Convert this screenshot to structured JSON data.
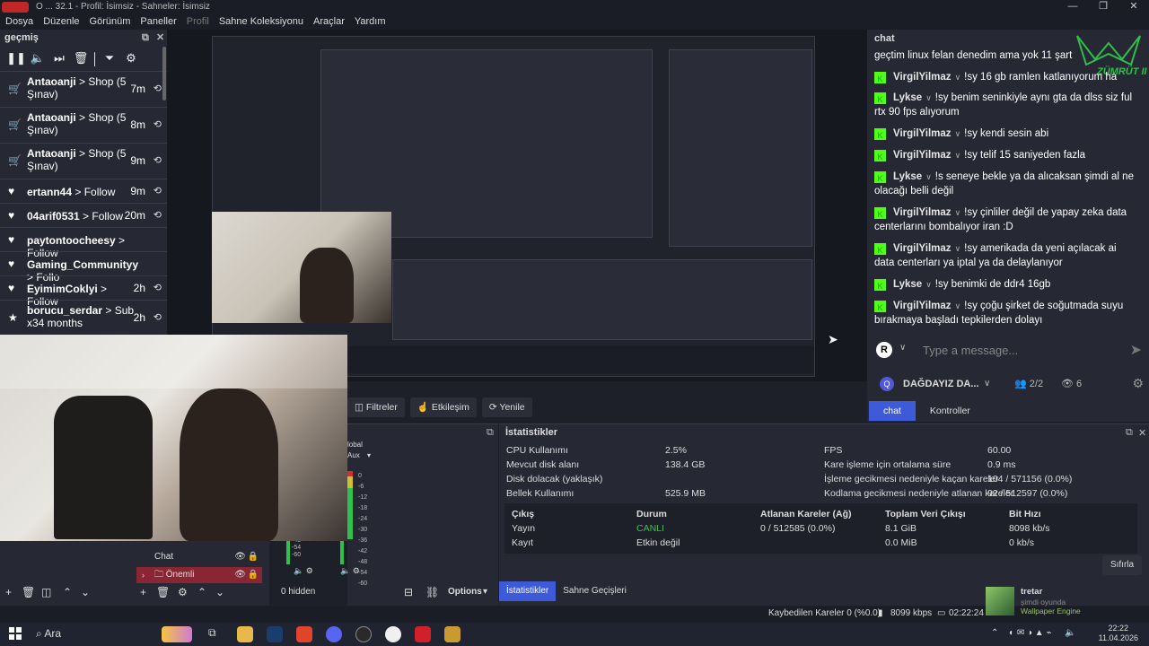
{
  "window": {
    "title": "O ... 32.1 - Profil: İsimsiz - Sahneler: İsimsiz",
    "controls": [
      "—",
      "❐",
      "✕"
    ]
  },
  "menu": [
    "Dosya",
    "Düzenle",
    "Görünüm",
    "Paneller",
    "Profil",
    "Sahne Koleksiyonu",
    "Araçlar",
    "Yardım"
  ],
  "left_dock": {
    "title": "geçmiş",
    "events": [
      {
        "icon": "cart",
        "user": "Antaoanji",
        "text": " > Shop (5 Şınav)",
        "time": "7m"
      },
      {
        "icon": "cart",
        "user": "Antaoanji",
        "text": " > Shop (5 Şınav)",
        "time": "8m"
      },
      {
        "icon": "cart",
        "user": "Antaoanji",
        "text": " > Shop (5 Şınav)",
        "time": "9m"
      },
      {
        "icon": "heart",
        "user": "ertann44",
        "text": " > Follow",
        "time": "9m"
      },
      {
        "icon": "heart",
        "user": "04arif0531",
        "text": " > Follow",
        "time": "20m"
      },
      {
        "icon": "heart",
        "user": "paytontoocheesy",
        "text": " > Follow",
        "time": ""
      },
      {
        "icon": "heart",
        "user": "Gaming_Communityy",
        "text": " > Follo",
        "time": ""
      },
      {
        "icon": "heart",
        "user": "EyimimCoklyi",
        "text": " > Follow",
        "time": "2h"
      },
      {
        "icon": "star",
        "user": "borucu_serdar",
        "text": " > Sub x34 months",
        "time": "2h"
      }
    ]
  },
  "chat": {
    "title": "chat",
    "logo_text": "ZÜMRÜT II",
    "messages": [
      {
        "user": "",
        "text": "geçtim linux felan denedim ama yok 11 şart"
      },
      {
        "user": "VirgilYilmaz",
        "text": "!sy 16 gb ramlen katlanıyorum ha"
      },
      {
        "user": "Lykse",
        "text": "!sy benim seninkiyle aynı gta da dlss siz ful rtx 90 fps alıyorum"
      },
      {
        "user": "VirgilYilmaz",
        "text": "!sy kendi sesin abi"
      },
      {
        "user": "VirgilYilmaz",
        "text": "!sy telif 15 saniyeden fazla"
      },
      {
        "user": "Lykse",
        "text": "!s seneye bekle ya da alıcaksan şimdi al ne olacağı belli değil"
      },
      {
        "user": "VirgilYilmaz",
        "text": "!sy çinliler değil de yapay zeka data centerlarını bombalıyor iran :D"
      },
      {
        "user": "VirgilYilmaz",
        "text": "!sy amerikada da yeni açılacak ai data centerları ya iptal ya da delaylanıyor"
      },
      {
        "user": "Lykse",
        "text": "!sy benimki de ddr4 16gb"
      },
      {
        "user": "VirgilYilmaz",
        "text": "!sy çoğu şirket de soğutmada suyu bırakmaya başladı tepkilerden dolayı"
      }
    ],
    "input_placeholder": "Type a message...",
    "avatar": "R",
    "channel": "DAĞDAYIZ DA...",
    "channel_avatar": "Q",
    "people": "2/2",
    "viewers": "6",
    "tabs": [
      "chat",
      "Kontroller"
    ]
  },
  "preview_toolbar": [
    "Filtreler",
    "Etkileşim",
    "Yenile"
  ],
  "stats": {
    "title": "İstatistikler",
    "left": [
      {
        "label": "CPU Kullanımı",
        "value": "2.5%"
      },
      {
        "label": "Mevcut disk alanı",
        "value": "138.4 GB"
      },
      {
        "label": "Disk dolacak (yaklaşık)",
        "value": ""
      },
      {
        "label": "Bellek Kullanımı",
        "value": "525.9 MB"
      }
    ],
    "right": [
      {
        "label": "FPS",
        "value": "60.00"
      },
      {
        "label": "Kare işleme için ortalama süre",
        "value": "0.9 ms"
      },
      {
        "label": "İşleme gecikmesi nedeniyle kaçan kareler",
        "value": "104 / 571156 (0.0%)"
      },
      {
        "label": "Kodlama gecikmesi nedeniyle atlanan kareler",
        "value": "92 / 512597 (0.0%)"
      }
    ],
    "output_headers": [
      "Çıkış",
      "Durum",
      "Atlanan Kareler (Ağ)",
      "Toplam Veri Çıkışı",
      "Bit Hızı"
    ],
    "output_rows": [
      [
        "Yayın",
        "CANLI",
        "0 / 512585 (0.0%)",
        "8.1 GiB",
        "8098 kb/s"
      ],
      [
        "Kayıt",
        "Etkin değil",
        "",
        "0.0 MiB",
        "0 kb/s"
      ]
    ],
    "live_color": "#3fbf4f",
    "reset": "Sıfırla",
    "tabs": [
      "İstatistikler",
      "Sahne Geçişleri"
    ]
  },
  "mixer": {
    "label": "lobal",
    "aux": "Aux",
    "db_marks": [
      "0",
      "-6",
      "-12",
      "-18",
      "-24",
      "-30",
      "-36",
      "-42",
      "-48",
      "-54",
      "-60"
    ]
  },
  "sources": [
    {
      "name": "Chat",
      "selected": false
    },
    {
      "name": "Önemli",
      "selected": true
    }
  ],
  "bottom": {
    "hidden": "0 hidden",
    "options": "Options"
  },
  "status": {
    "dropped": "Kaybedilen Kareler 0 (%0.0)",
    "kbps": "8099 kbps",
    "time": "02:22:24"
  },
  "notification": {
    "user": "tretar",
    "line1": "şimdi oyunda",
    "line2": "Wallpaper Engine"
  },
  "taskbar": {
    "search": "Ara",
    "time": "22:22",
    "date": "11.04.2026"
  },
  "colors": {
    "accent": "#3d5ad9",
    "kick_green": "#53fc18",
    "selected_source": "#8a2533"
  }
}
